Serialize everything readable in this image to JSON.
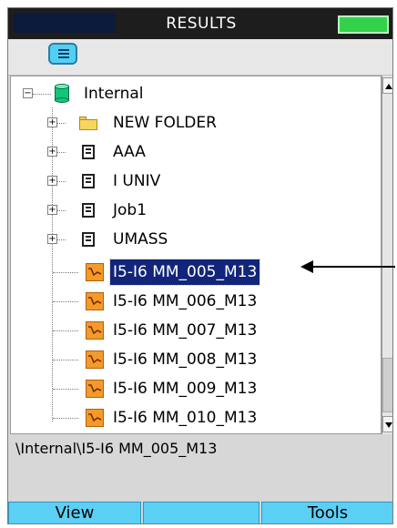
{
  "window": {
    "title": "RESULTS"
  },
  "colors": {
    "accent": "#5ccff5",
    "selection": "#12257a",
    "battery": "#32d24a"
  },
  "tree": {
    "root": {
      "label": "Internal",
      "icon": "database-icon",
      "expanded": true
    },
    "items": [
      {
        "label": "NEW FOLDER",
        "icon": "folder-icon",
        "type": "folder"
      },
      {
        "label": "AAA",
        "icon": "job-icon",
        "type": "job"
      },
      {
        "label": "I UNIV",
        "icon": "job-icon",
        "type": "job"
      },
      {
        "label": "Job1",
        "icon": "job-icon",
        "type": "job"
      },
      {
        "label": "UMASS",
        "icon": "job-icon",
        "type": "job"
      },
      {
        "label": "I5-I6 MM_005_M13",
        "icon": "trace-icon",
        "type": "result",
        "selected": true
      },
      {
        "label": "I5-I6 MM_006_M13",
        "icon": "trace-icon",
        "type": "result"
      },
      {
        "label": "I5-I6 MM_007_M13",
        "icon": "trace-icon",
        "type": "result"
      },
      {
        "label": "I5-I6 MM_008_M13",
        "icon": "trace-icon",
        "type": "result"
      },
      {
        "label": "I5-I6 MM_009_M13",
        "icon": "trace-icon",
        "type": "result"
      },
      {
        "label": "I5-I6 MM_010_M13",
        "icon": "trace-icon",
        "type": "result"
      }
    ]
  },
  "path_bar": {
    "text": "\\Internal\\I5-I6 MM_005_M13"
  },
  "softkeys": [
    "View",
    "",
    "Tools"
  ]
}
